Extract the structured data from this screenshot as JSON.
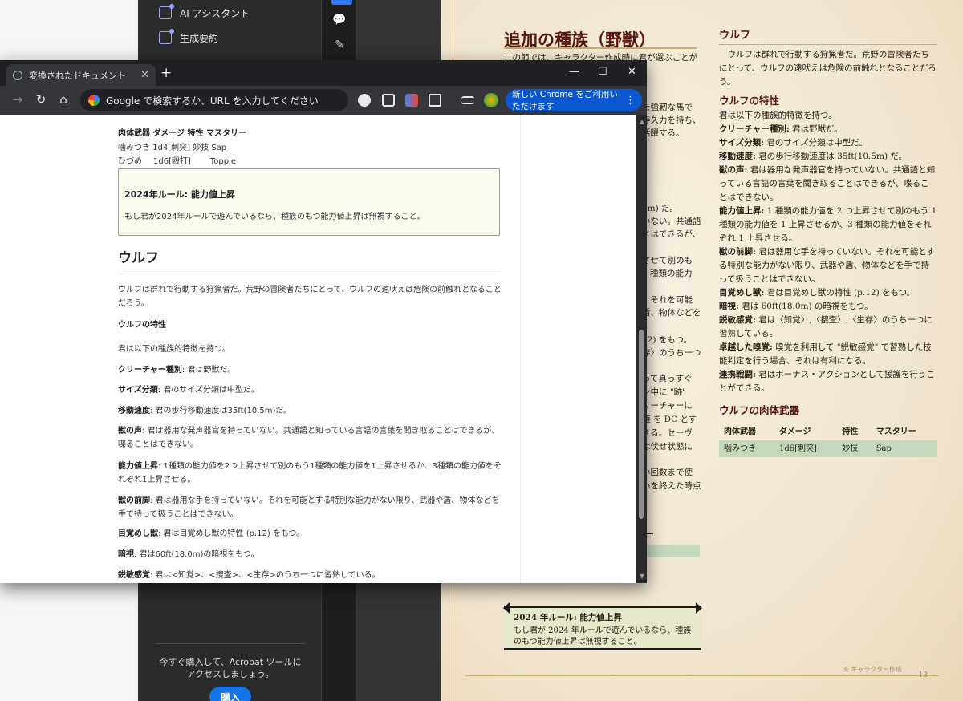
{
  "acrobat": {
    "menu": [
      {
        "label": "AI アシスタント"
      },
      {
        "label": "生成要約"
      }
    ],
    "promo_text": "今すぐ購入して、Acrobat ツールにアクセスしましょう。",
    "buy_label": "購入"
  },
  "pdf": {
    "title": "追加の種族（野獣）",
    "intro": "この節では、キャラクター作成時に君が選ぶことがで",
    "column_fragments": [
      "た強靭な馬で",
      "寺久力を持ち、",
      "活躍する。",
      "5m) だ。",
      "いない。共通語",
      "とはできるが、",
      "させて別のも",
      "3 種類の能力",
      "。それを可能",
      "盾、物体などを",
      "12) をもつ。",
      "存〉のうち一つ",
      "って真っすぐ",
      "ン中に \"跡\"",
      "リーチャーに",
      "値 を DC とす",
      "きる。セーヴ",
      "は伏せ状態に",
      "い回数まで使",
      "いを終えた時点"
    ],
    "wolf_heading": "ウルフ",
    "wolf_intro": "ウルフは群れで行動する狩猟者だ。荒野の冒険者たちにとって、ウルフの遠吠えは危険の前触れとなることだろう。",
    "traits_heading": "ウルフの特性",
    "traits_intro": "君は以下の種族的特徴を持つ。",
    "traits": [
      {
        "name": "クリーチャー種別:",
        "text": "君は野獣だ。"
      },
      {
        "name": "サイズ分類:",
        "text": "君のサイズ分類は中型だ。"
      },
      {
        "name": "移動速度:",
        "text": "君の歩行移動速度は 35ft(10.5m) だ。"
      },
      {
        "name": "獣の声:",
        "text": "君は器用な発声器官を持っていない。共通語と知っている言語の言葉を聞き取ることはできるが、喋ることはできない。"
      },
      {
        "name": "能力値上昇:",
        "text": "1 種類の能力値を 2 つ上昇させて別のもう 1 種類の能力値を 1 上昇させるか、3 種類の能力値をそれぞれ 1 上昇させる。"
      },
      {
        "name": "獣の前脚:",
        "text": "君は器用な手を持っていない。それを可能とする特別な能力がない限り、武器や盾、物体などを手で持って扱うことはできない。"
      },
      {
        "name": "目覚めし獣:",
        "text": "君は目覚めし獣の特性 (p.12) をもつ。"
      },
      {
        "name": "暗視:",
        "text": "君は 60ft(18.0m) の暗視をもつ。"
      },
      {
        "name": "鋭敏感覚:",
        "text": "君は〈知覚〉,〈捜査〉,〈生存〉のうち一つに習熟している。"
      },
      {
        "name": "卓越した嗅覚:",
        "text": " 嗅覚を利用して \"鋭敏感覚\" で習熟した技能判定を行う場合、それは有利になる。"
      },
      {
        "name": "連携戦闘:",
        "text": "君はボーナス・アクションとして援護を行うことができる。"
      }
    ],
    "weapons_heading": "ウルフの肉体武器",
    "weapons_table": {
      "headers": [
        "肉体武器",
        "ダメージ",
        "特性",
        "マスタリー"
      ],
      "rows": [
        [
          "噛みつき",
          "1d6[刺突]",
          "妙技",
          "Sap"
        ]
      ]
    },
    "note_title": "2024 年ルール: 能力値上昇",
    "note_body": "もし君が 2024 年ルールで遊んでいるなら、種族のもつ能力値上昇は無視すること。",
    "footer": "3: キャラクター作成",
    "page_number": "13"
  },
  "chrome": {
    "tab_title": "変換されたドキュメント",
    "omnibox_placeholder": "Google で検索するか、URL を入力してください",
    "update_label": "新しい Chrome をご利用いただけます",
    "doc": {
      "line0": "",
      "weapon_header": "肉体武器 ダメージ 特性 マスタリー",
      "weapon_row1": "噛みつき 1d4[刺突] 妙技 Sap",
      "weapon_row2_name": "ひづめ",
      "weapon_row2_dmg": "1d6[殴打]",
      "weapon_row2_mastery": "Topple",
      "box_title": "2024年ルール: 能力値上昇",
      "box_body": "もし君が2024年ルールで遊んでいるなら、種族のもつ能力値上昇は無視すること。",
      "heading": "ウルフ",
      "intro": "ウルフは群れで行動する狩猟者だ。荒野の冒険者たちにとって、ウルフの遠吠えは危険の前触れとなることだろう。",
      "traits_heading": "ウルフの特性",
      "traits_intro": "君は以下の種族的特徴を持つ。",
      "traits": [
        {
          "name": "クリーチャー種別",
          "text": ": 君は野獣だ。"
        },
        {
          "name": "サイズ分類",
          "text": ": 君のサイズ分類は中型だ。"
        },
        {
          "name": "移動速度",
          "text": ": 君の歩行移動速度は35ft(10.5m)だ。"
        },
        {
          "name": "獣の声",
          "text": ": 君は器用な発声器官を持っていない。共通語と知っている言語の言葉を聞き取ることはできるが、喋ることはできない。"
        },
        {
          "name": "能力値上昇",
          "text": ": 1種類の能力値を2つ上昇させて別のもう1種類の能力値を1上昇させるか、3種類の能力値をそれぞれ1上昇させる。"
        },
        {
          "name": "獣の前脚",
          "text": ": 君は器用な手を持っていない。それを可能とする特別な能力がない限り、武器や盾、物体などを手で持って扱うことはできない。"
        },
        {
          "name": "目覚めし獣",
          "text": ": 君は目覚めし獣の特性 (p.12) をもつ。"
        },
        {
          "name": "暗視",
          "text": ": 君は60ft(18.0m)の暗視をもつ。"
        },
        {
          "name": "鋭敏感覚",
          "text": ": 君は<知覚>、<捜査>、<生存>のうち一つに習熟している。"
        }
      ]
    }
  }
}
